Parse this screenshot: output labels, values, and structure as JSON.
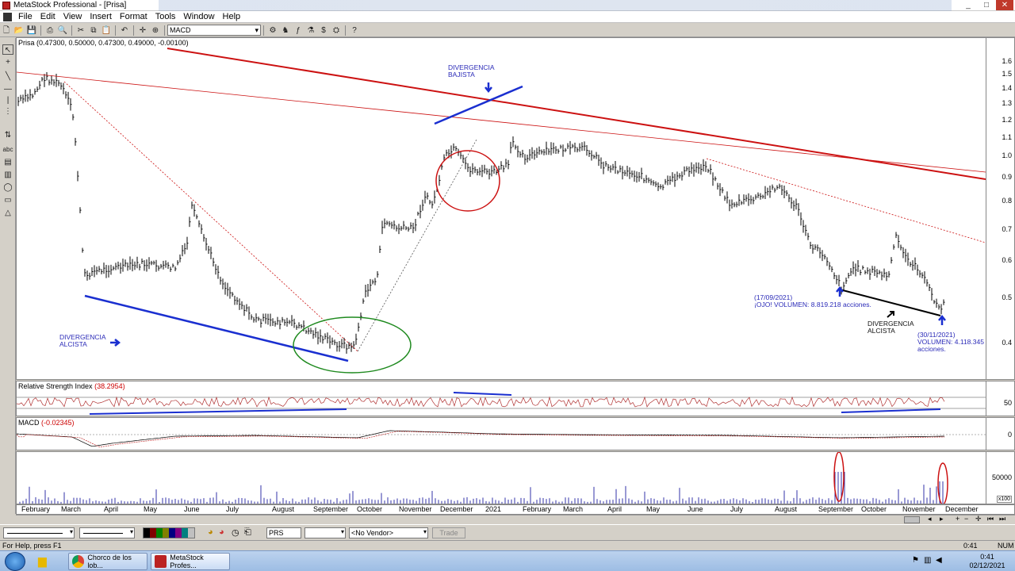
{
  "window": {
    "title": "MetaStock Professional - [Prisa]",
    "controls": [
      "_",
      "□",
      "✕"
    ]
  },
  "menu": [
    "File",
    "Edit",
    "View",
    "Insert",
    "Format",
    "Tools",
    "Window",
    "Help"
  ],
  "toolbar": {
    "indicator_select": "MACD"
  },
  "price_panel": {
    "title": "Prisa (0.47300, 0.50000, 0.47300, 0.49000, -0.00100)",
    "y_ticks": [
      "1.6",
      "1.5",
      "1.4",
      "1.3",
      "1.2",
      "1.1",
      "1.0",
      "0.9",
      "0.8",
      "0.7",
      "0.6",
      "0.5",
      "0.4"
    ],
    "annotations": {
      "bearish_div_line1": "DIVERGENCIA",
      "bearish_div_line2": "BAJISTA",
      "bullish_div_left_line1": "DIVERGENCIA",
      "bullish_div_left_line2": "ALCISTA",
      "note1_line1": "(17/09/2021)",
      "note1_line2": "¡OJO! VOLUMEN: 8.819.218 acciones.",
      "bullish_div_right_line1": "DIVERGENCIA",
      "bullish_div_right_line2": "ALCISTA",
      "note2_line1": "(30/11/2021)",
      "note2_line2": "VOLUMEN: 4.118.345",
      "note2_line3": "acciones."
    }
  },
  "rsi_panel": {
    "title_prefix": "Relative Strength Index",
    "title_value": "(38.2954)",
    "y_ticks": [
      "50"
    ]
  },
  "macd_panel": {
    "title_prefix": "MACD",
    "title_value": "(-0.02345)",
    "y_ticks": [
      "0"
    ]
  },
  "volume_panel": {
    "y_ticks": [
      "50000"
    ],
    "scale_badge": "x100"
  },
  "date_axis": [
    "February",
    "March",
    "April",
    "May",
    "June",
    "July",
    "August",
    "September",
    "October",
    "November",
    "December",
    "2021",
    "February",
    "March",
    "April",
    "May",
    "June",
    "July",
    "August",
    "September",
    "October",
    "November",
    "December"
  ],
  "bottom": {
    "symbol_field": "PRS",
    "vendor_select": "<No Vendor>",
    "trade_button": "Trade"
  },
  "status": {
    "help_text": "For Help, press F1",
    "time": "0:41",
    "num": "NUM"
  },
  "taskbar": {
    "chrome_task": "Chorco de los lob...",
    "metastock_task": "MetaStock Profes...",
    "clock_time": "0:41",
    "clock_date": "02/12/2021"
  },
  "colors": {
    "trend_red": "#cc1111",
    "divergence_blue": "#1a2fd0",
    "annotation_blue": "#2b2bb8",
    "circle_green": "#1f8a1f",
    "circle_red": "#cc1111"
  }
}
